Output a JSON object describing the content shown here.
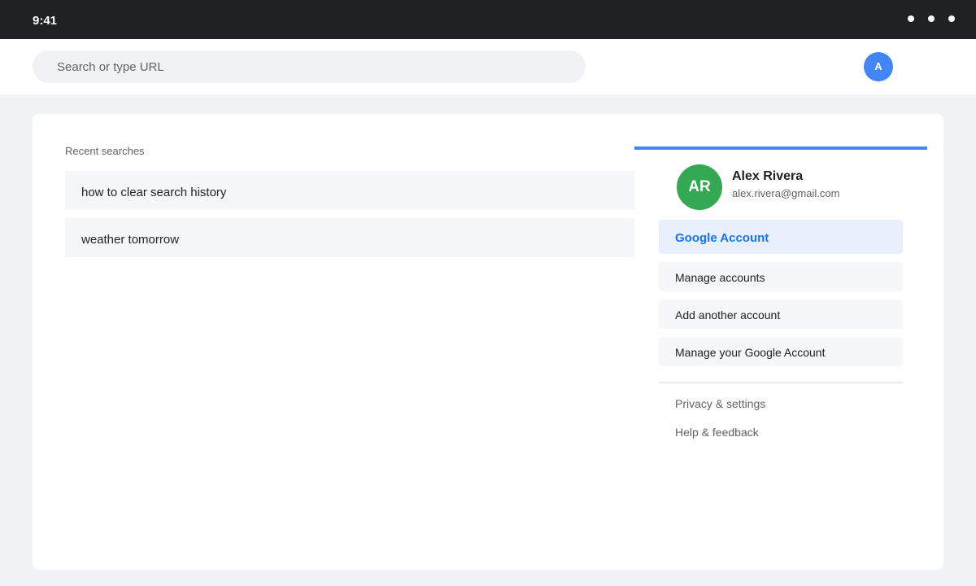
{
  "status_bar": {
    "time": "9:41",
    "icons": [
      "dot-icon",
      "dot-icon",
      "dot-icon"
    ]
  },
  "toolbar": {
    "search_placeholder": "Search or type URL",
    "search_value": "",
    "avatar_initial": "A",
    "avatar_color": "#4285f4"
  },
  "recent": {
    "heading": "Recent searches",
    "items": [
      {
        "label": "how to clear search history"
      },
      {
        "label": "weather tomorrow"
      }
    ]
  },
  "account_panel": {
    "accent_color": "#4285f4",
    "avatar_initials": "AR",
    "avatar_color": "#34a853",
    "name": "Alex Rivera",
    "email": "alex.rivera@gmail.com",
    "primary_item": "Google Account",
    "items": [
      {
        "label": "Manage accounts"
      },
      {
        "label": "Add another account"
      },
      {
        "label": "Manage your Google Account"
      }
    ],
    "links": [
      {
        "label": "Privacy & settings"
      },
      {
        "label": "Help & feedback"
      }
    ]
  }
}
